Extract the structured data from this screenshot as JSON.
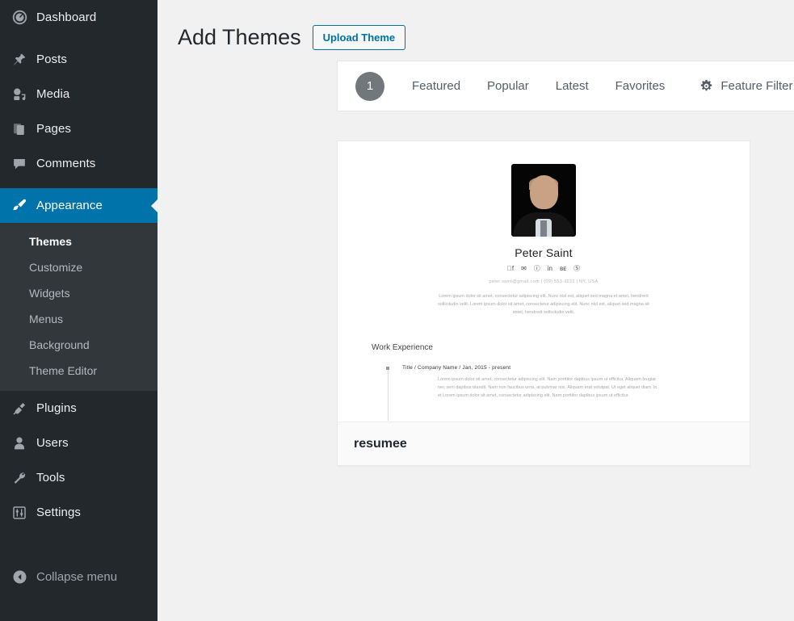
{
  "sidebar": {
    "items": [
      {
        "label": "Dashboard",
        "icon": "dashboard-icon",
        "state": "normal"
      },
      {
        "label": "Posts",
        "icon": "pin-icon",
        "state": "normal"
      },
      {
        "label": "Media",
        "icon": "media-icon",
        "state": "normal"
      },
      {
        "label": "Pages",
        "icon": "pages-icon",
        "state": "normal"
      },
      {
        "label": "Comments",
        "icon": "comment-icon",
        "state": "normal"
      },
      {
        "label": "Appearance",
        "icon": "paintbrush-icon",
        "state": "current"
      },
      {
        "label": "Plugins",
        "icon": "plug-icon",
        "state": "normal"
      },
      {
        "label": "Users",
        "icon": "user-icon",
        "state": "normal"
      },
      {
        "label": "Tools",
        "icon": "wrench-icon",
        "state": "normal"
      },
      {
        "label": "Settings",
        "icon": "sliders-icon",
        "state": "normal"
      }
    ],
    "submenu": [
      {
        "label": "Themes",
        "state": "current"
      },
      {
        "label": "Customize",
        "state": "normal"
      },
      {
        "label": "Widgets",
        "state": "normal"
      },
      {
        "label": "Menus",
        "state": "normal"
      },
      {
        "label": "Background",
        "state": "normal"
      },
      {
        "label": "Theme Editor",
        "state": "normal"
      }
    ],
    "collapse": {
      "label": "Collapse menu",
      "icon": "collapse-left-icon"
    },
    "colors": {
      "background": "#23282d",
      "submenu_background": "#32373c",
      "current": "#0073aa"
    }
  },
  "header": {
    "title": "Add Themes",
    "upload_button": "Upload Theme"
  },
  "filter_bar": {
    "count": "1",
    "tabs": [
      {
        "label": "Featured"
      },
      {
        "label": "Popular"
      },
      {
        "label": "Latest"
      },
      {
        "label": "Favorites"
      }
    ],
    "feature_filter": {
      "label": "Feature Filter",
      "icon": "gear-icon"
    }
  },
  "theme_card": {
    "name": "resumee",
    "preview": {
      "person_name": "Peter Saint",
      "social_icons": [
        "facebook-icon",
        "twitter-icon",
        "dribbble-icon",
        "linkedin-icon",
        "behance-icon",
        "skype-icon"
      ],
      "contact_line": "peter.saint@gmail.com  |  (09) 553-3222  |  NY, USA",
      "intro_paragraph": "Lorem ipsum dolor sit amet, consectetur adipiscing elit. Nunc nisl est, aliquet sed magna et amet, hendrerit sollicitudin velit. Lorem ipsum dolor sit amet, consectetur adipiscing elit. Nunc nisl est, aliquet sed magna sit amet, hendrerit sollicitudin velit.",
      "section_heading": "Work Experience",
      "entry_title": "Title / Company Name / Jan, 2015 - present",
      "entry_body": "Lorem ipsum dolor sit amet, consectetur adipiscing elit. Nam porttitor dapibus ipsum ut efficitur. Aliquam feugiat nec sem dapibus blandit. Nam non faucibus urna, at pulvinar nisi. Aliquam erat volutpat. Ut eget aliquet diam. In et Lorem ipsum dolor sit amet, consectetur adipiscing elit. Nam porttitor dapibus ipsum ut efficitur."
    }
  }
}
